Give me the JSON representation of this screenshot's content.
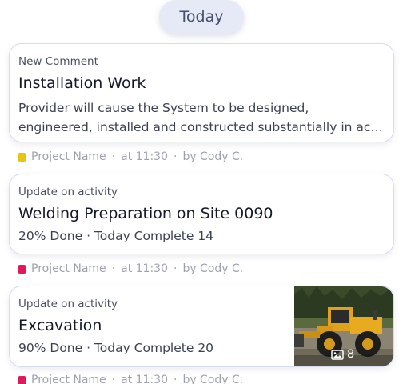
{
  "header": {
    "date_label": "Today"
  },
  "feed": [
    {
      "kind": "New Comment",
      "title": "Installation Work",
      "description_line1": "Provider will cause the System to be designed,",
      "description_line2": "engineered, installed and constructed substantially in accordance with the plans",
      "meta": {
        "project": "Project Name",
        "time": "at 11:30",
        "author": "by Cody C.",
        "dot_color": "#e6c514"
      }
    },
    {
      "kind": "Update on activity",
      "title": "Welding Preparation on Site 0090",
      "progress": "20% Done · Today Complete 14",
      "meta": {
        "project": "Project Name",
        "time": "at 11:30",
        "author": "by Cody C.",
        "dot_color": "#e0195a"
      }
    },
    {
      "kind": "Update on activity",
      "title": "Excavation",
      "progress": "90% Done · Today Complete 20",
      "photo_count": "8",
      "meta": {
        "project": "Project Name",
        "time": "at 11:30",
        "author": "by Cody C.",
        "dot_color": "#e0195a"
      }
    }
  ],
  "separator": "·",
  "icons": {
    "photo_gallery": "image-icon",
    "project_tag": "color-square"
  }
}
